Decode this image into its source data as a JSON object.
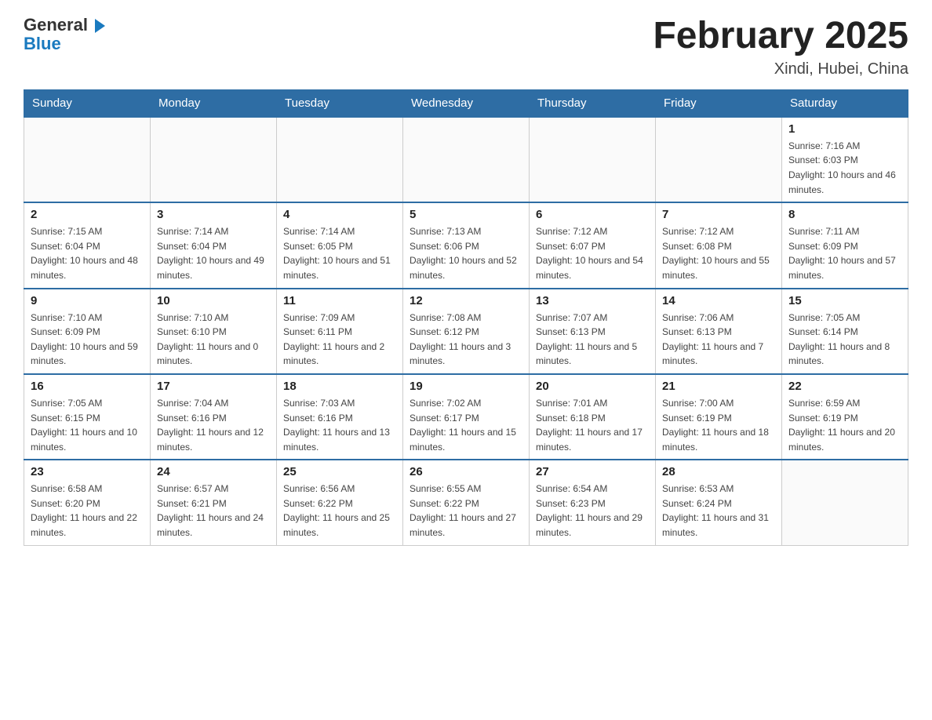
{
  "logo": {
    "general": "General",
    "blue": "Blue"
  },
  "title": "February 2025",
  "subtitle": "Xindi, Hubei, China",
  "days_of_week": [
    "Sunday",
    "Monday",
    "Tuesday",
    "Wednesday",
    "Thursday",
    "Friday",
    "Saturday"
  ],
  "weeks": [
    [
      {
        "day": "",
        "info": ""
      },
      {
        "day": "",
        "info": ""
      },
      {
        "day": "",
        "info": ""
      },
      {
        "day": "",
        "info": ""
      },
      {
        "day": "",
        "info": ""
      },
      {
        "day": "",
        "info": ""
      },
      {
        "day": "1",
        "info": "Sunrise: 7:16 AM\nSunset: 6:03 PM\nDaylight: 10 hours and 46 minutes."
      }
    ],
    [
      {
        "day": "2",
        "info": "Sunrise: 7:15 AM\nSunset: 6:04 PM\nDaylight: 10 hours and 48 minutes."
      },
      {
        "day": "3",
        "info": "Sunrise: 7:14 AM\nSunset: 6:04 PM\nDaylight: 10 hours and 49 minutes."
      },
      {
        "day": "4",
        "info": "Sunrise: 7:14 AM\nSunset: 6:05 PM\nDaylight: 10 hours and 51 minutes."
      },
      {
        "day": "5",
        "info": "Sunrise: 7:13 AM\nSunset: 6:06 PM\nDaylight: 10 hours and 52 minutes."
      },
      {
        "day": "6",
        "info": "Sunrise: 7:12 AM\nSunset: 6:07 PM\nDaylight: 10 hours and 54 minutes."
      },
      {
        "day": "7",
        "info": "Sunrise: 7:12 AM\nSunset: 6:08 PM\nDaylight: 10 hours and 55 minutes."
      },
      {
        "day": "8",
        "info": "Sunrise: 7:11 AM\nSunset: 6:09 PM\nDaylight: 10 hours and 57 minutes."
      }
    ],
    [
      {
        "day": "9",
        "info": "Sunrise: 7:10 AM\nSunset: 6:09 PM\nDaylight: 10 hours and 59 minutes."
      },
      {
        "day": "10",
        "info": "Sunrise: 7:10 AM\nSunset: 6:10 PM\nDaylight: 11 hours and 0 minutes."
      },
      {
        "day": "11",
        "info": "Sunrise: 7:09 AM\nSunset: 6:11 PM\nDaylight: 11 hours and 2 minutes."
      },
      {
        "day": "12",
        "info": "Sunrise: 7:08 AM\nSunset: 6:12 PM\nDaylight: 11 hours and 3 minutes."
      },
      {
        "day": "13",
        "info": "Sunrise: 7:07 AM\nSunset: 6:13 PM\nDaylight: 11 hours and 5 minutes."
      },
      {
        "day": "14",
        "info": "Sunrise: 7:06 AM\nSunset: 6:13 PM\nDaylight: 11 hours and 7 minutes."
      },
      {
        "day": "15",
        "info": "Sunrise: 7:05 AM\nSunset: 6:14 PM\nDaylight: 11 hours and 8 minutes."
      }
    ],
    [
      {
        "day": "16",
        "info": "Sunrise: 7:05 AM\nSunset: 6:15 PM\nDaylight: 11 hours and 10 minutes."
      },
      {
        "day": "17",
        "info": "Sunrise: 7:04 AM\nSunset: 6:16 PM\nDaylight: 11 hours and 12 minutes."
      },
      {
        "day": "18",
        "info": "Sunrise: 7:03 AM\nSunset: 6:16 PM\nDaylight: 11 hours and 13 minutes."
      },
      {
        "day": "19",
        "info": "Sunrise: 7:02 AM\nSunset: 6:17 PM\nDaylight: 11 hours and 15 minutes."
      },
      {
        "day": "20",
        "info": "Sunrise: 7:01 AM\nSunset: 6:18 PM\nDaylight: 11 hours and 17 minutes."
      },
      {
        "day": "21",
        "info": "Sunrise: 7:00 AM\nSunset: 6:19 PM\nDaylight: 11 hours and 18 minutes."
      },
      {
        "day": "22",
        "info": "Sunrise: 6:59 AM\nSunset: 6:19 PM\nDaylight: 11 hours and 20 minutes."
      }
    ],
    [
      {
        "day": "23",
        "info": "Sunrise: 6:58 AM\nSunset: 6:20 PM\nDaylight: 11 hours and 22 minutes."
      },
      {
        "day": "24",
        "info": "Sunrise: 6:57 AM\nSunset: 6:21 PM\nDaylight: 11 hours and 24 minutes."
      },
      {
        "day": "25",
        "info": "Sunrise: 6:56 AM\nSunset: 6:22 PM\nDaylight: 11 hours and 25 minutes."
      },
      {
        "day": "26",
        "info": "Sunrise: 6:55 AM\nSunset: 6:22 PM\nDaylight: 11 hours and 27 minutes."
      },
      {
        "day": "27",
        "info": "Sunrise: 6:54 AM\nSunset: 6:23 PM\nDaylight: 11 hours and 29 minutes."
      },
      {
        "day": "28",
        "info": "Sunrise: 6:53 AM\nSunset: 6:24 PM\nDaylight: 11 hours and 31 minutes."
      },
      {
        "day": "",
        "info": ""
      }
    ]
  ]
}
